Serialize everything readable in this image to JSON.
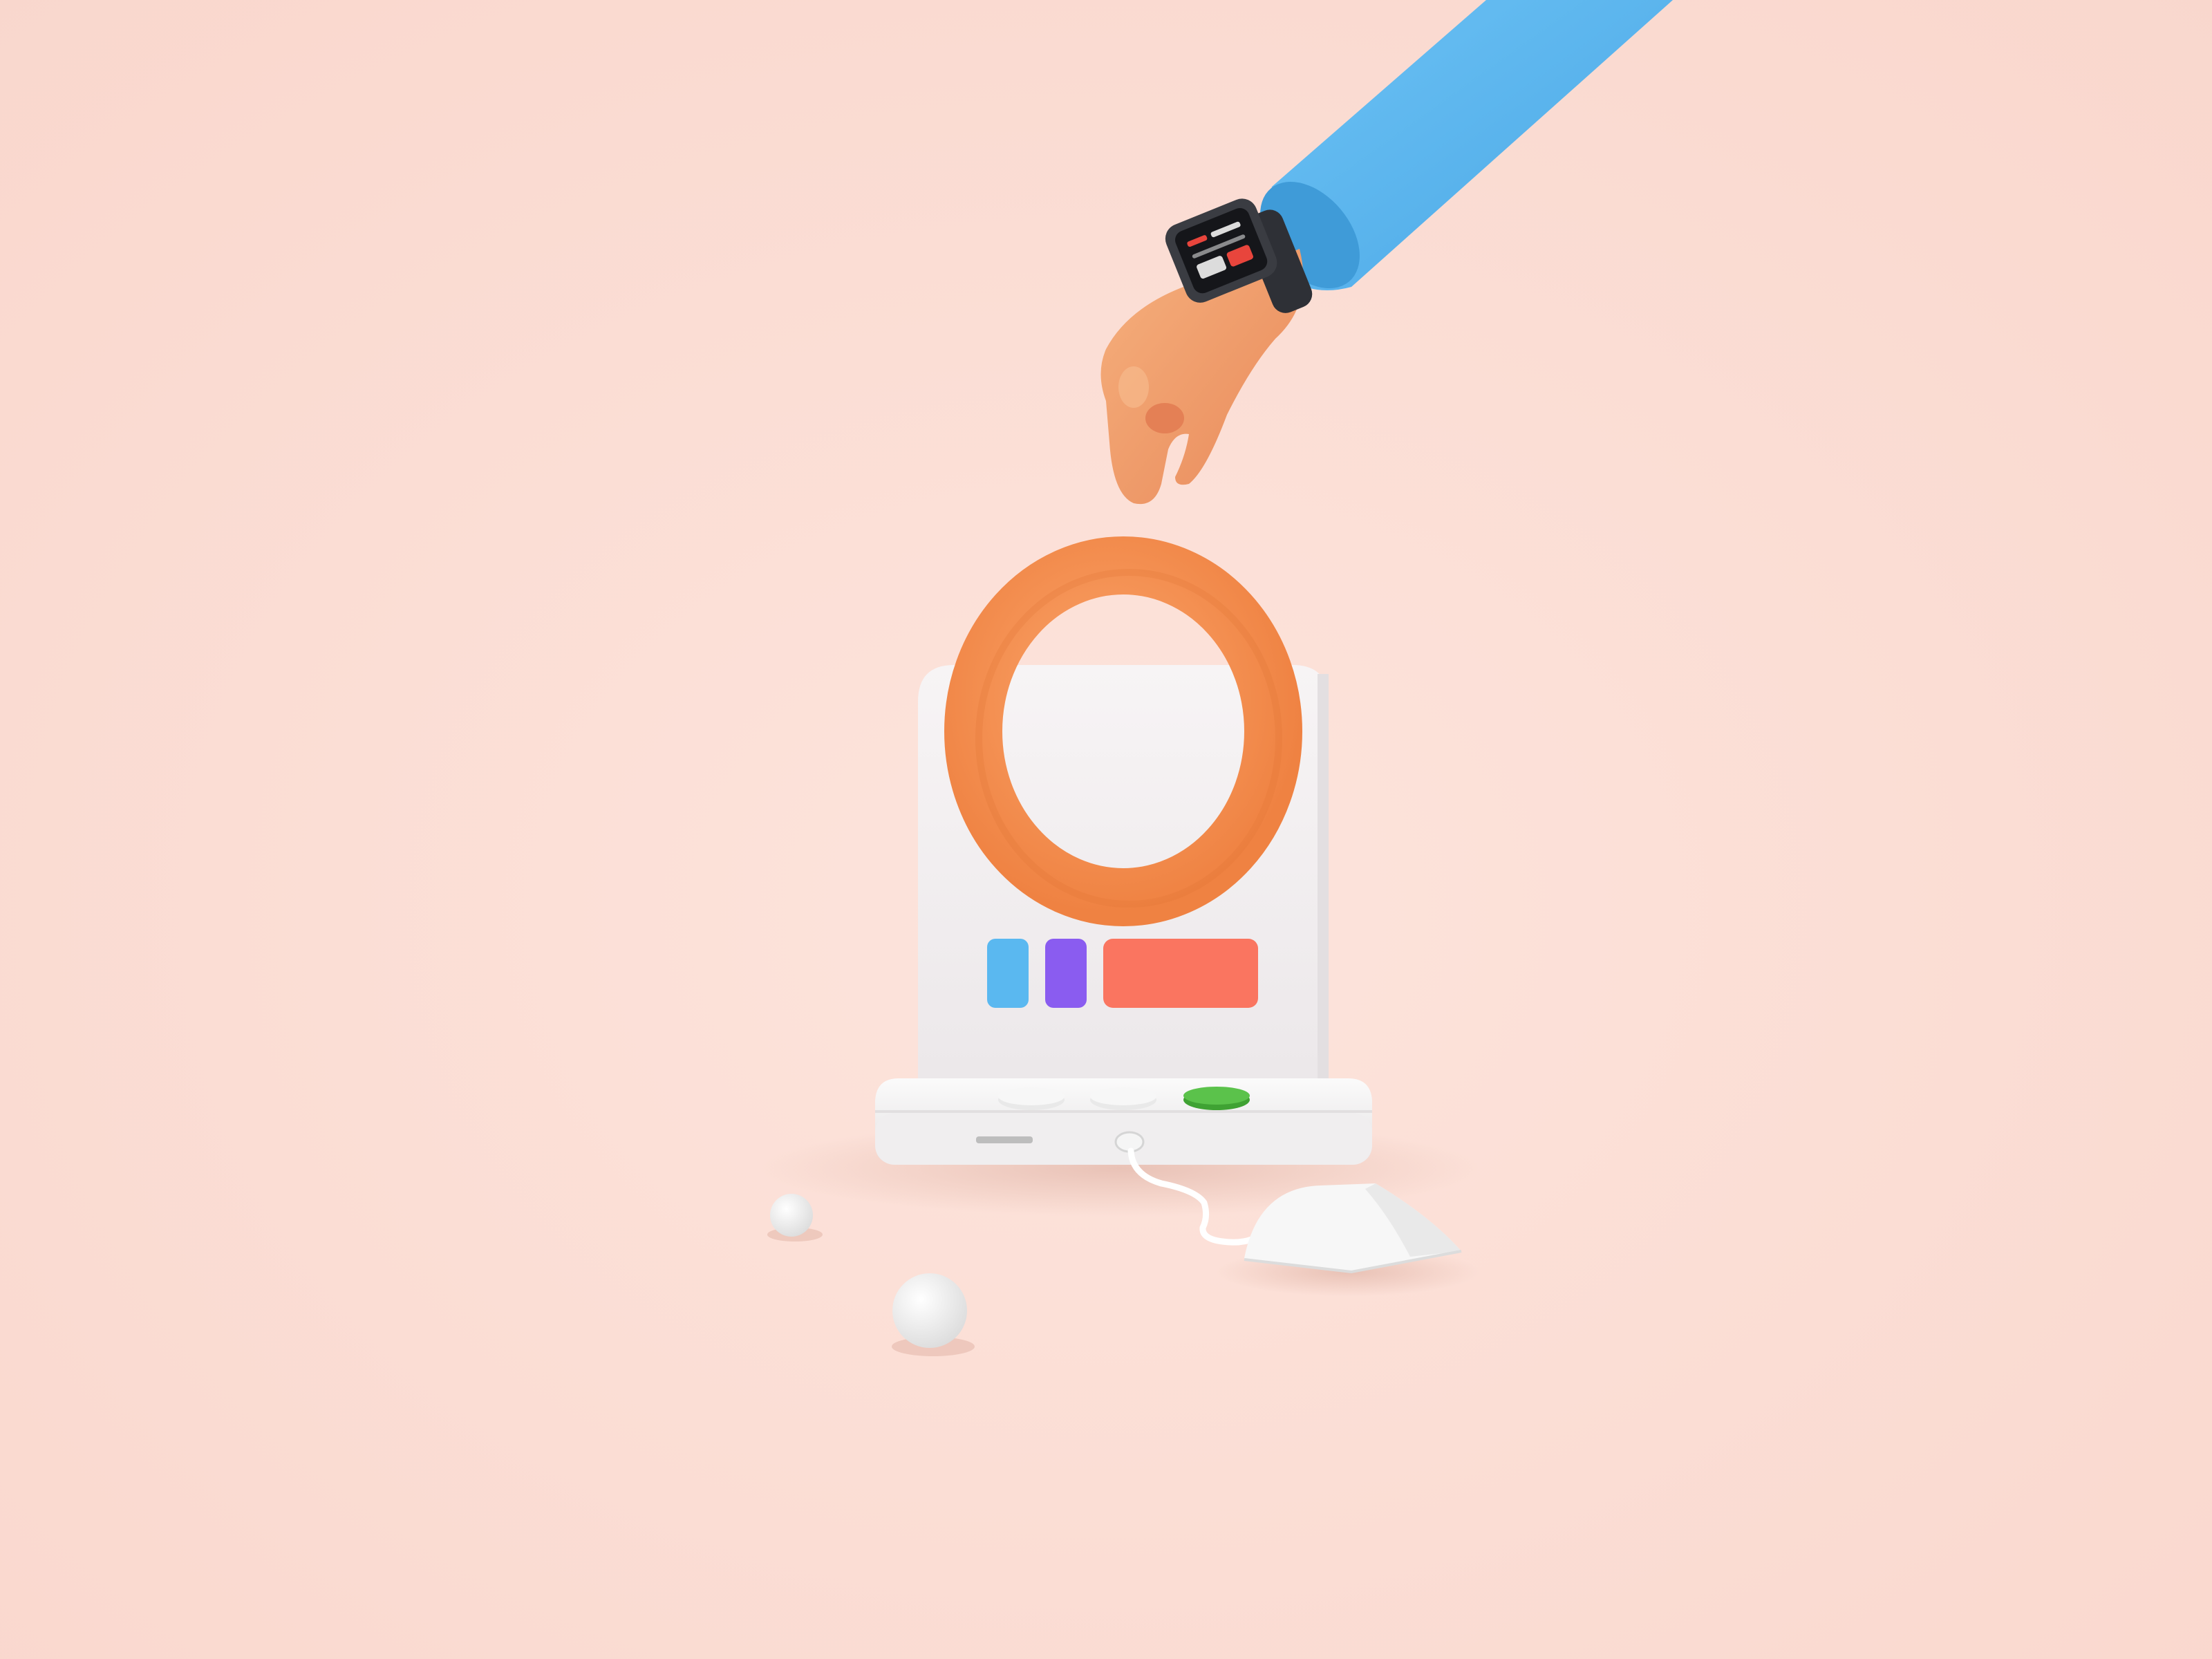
{
  "scene": {
    "background": "#fbdcd3",
    "objects": [
      "sleeve",
      "hand",
      "smartwatch",
      "ring",
      "laptop",
      "buttons",
      "cable",
      "mouse",
      "spheres"
    ]
  },
  "colors": {
    "sleeve": "#5ab4ef",
    "sleeve_shadow": "#3f9bd8",
    "skin": "#f2a06c",
    "skin_shadow": "#d9814e",
    "watch_body": "#2e3036",
    "watch_screen": "#15161a",
    "ring": "#f7924d",
    "ring_shadow": "#e07434",
    "device": "#f4f1f2",
    "device_shade": "#e6e1e3",
    "button_blue": "#5ab8f0",
    "button_purple": "#8a5cf0",
    "button_coral": "#fa7560",
    "key_white": "#f5f5f5",
    "key_green": "#5bc24b",
    "port": "#bdbdbd"
  }
}
